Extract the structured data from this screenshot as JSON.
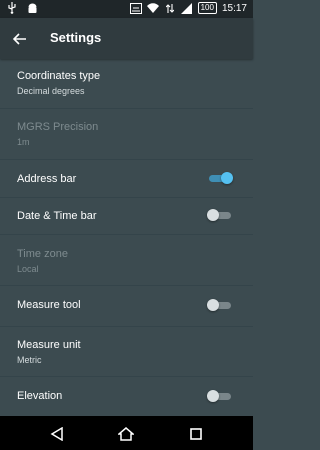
{
  "status_bar": {
    "icons_left": [
      "usb-icon",
      "android-icon"
    ],
    "icons_right": [
      "cast-icon",
      "wifi-icon",
      "data-icon",
      "signal-icon",
      "battery-icon"
    ],
    "battery": "100",
    "time": "15:17"
  },
  "app_bar": {
    "title": "Settings",
    "back_icon": "arrow-back-icon"
  },
  "settings": [
    {
      "label": "Coordinates type",
      "value": "Decimal degrees",
      "enabled": true
    },
    {
      "label": "MGRS Precision",
      "value": "1m",
      "enabled": false
    },
    {
      "label": "Address bar",
      "toggle": true,
      "enabled": true
    },
    {
      "label": "Date & Time bar",
      "toggle": false,
      "enabled": true
    },
    {
      "label": "Time zone",
      "value": "Local",
      "enabled": false
    },
    {
      "label": "Measure tool",
      "toggle": false,
      "enabled": true
    },
    {
      "label": "Measure unit",
      "value": "Metric",
      "enabled": true
    },
    {
      "label": "Elevation",
      "toggle": false,
      "enabled": true
    }
  ],
  "nav_bar": {
    "icons": [
      "back-triangle-icon",
      "home-icon",
      "recents-icon"
    ]
  },
  "colors": {
    "background": "#3c4b50",
    "app_bar": "#303b3f",
    "accent": "#55c1f1"
  }
}
